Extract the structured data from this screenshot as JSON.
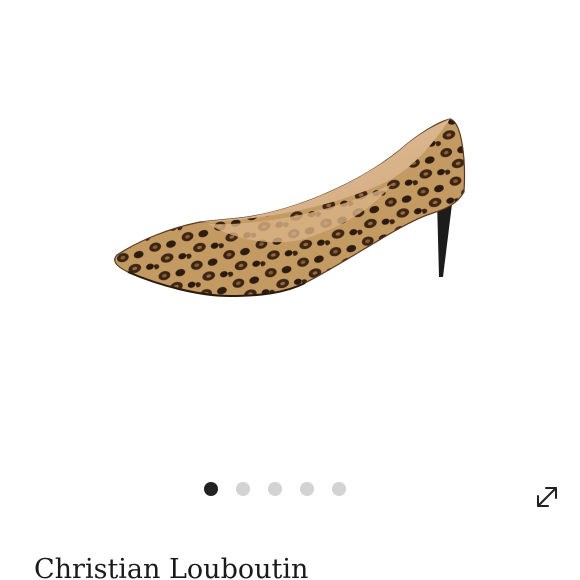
{
  "product": {
    "brand": "Christian Louboutin",
    "image_icon": "leopard-print-pump-image"
  },
  "carousel": {
    "slides": [
      {
        "active": true
      },
      {
        "active": false
      },
      {
        "active": false
      },
      {
        "active": false
      },
      {
        "active": false
      }
    ],
    "expand_icon": "expand-arrows-icon"
  },
  "colors": {
    "active_dot": "#222222",
    "inactive_dot": "#d3d3d3",
    "text": "#1a1a1a"
  }
}
